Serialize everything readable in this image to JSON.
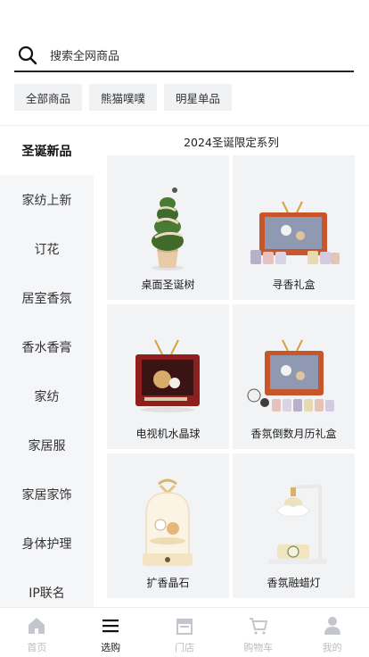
{
  "search": {
    "placeholder": "搜索全网商品",
    "icon": "search-icon"
  },
  "chips": [
    "全部商品",
    "熊猫噗噗",
    "明星单品"
  ],
  "sidebar": {
    "items": [
      "圣诞新品",
      "家纺上新",
      "订花",
      "居室香氛",
      "香水香膏",
      "家纺",
      "家居服",
      "家居家饰",
      "身体护理",
      "IP联名"
    ],
    "active_index": 0
  },
  "section": {
    "title": "2024圣诞限定系列"
  },
  "products": [
    {
      "name": "桌面圣诞树",
      "icon": "christmas-tree-image"
    },
    {
      "name": "寻香礼盒",
      "icon": "retro-tv-gift-box-image"
    },
    {
      "name": "电视机水晶球",
      "icon": "tv-crystal-ball-image"
    },
    {
      "name": "香氛倒数月历礼盒",
      "icon": "advent-calendar-gift-box-image"
    },
    {
      "name": "扩香晶石",
      "icon": "diffuser-crystal-dome-image"
    },
    {
      "name": "香氛融蜡灯",
      "icon": "wax-melt-lamp-image"
    }
  ],
  "tabbar": {
    "items": [
      {
        "label": "首页",
        "icon": "home-icon"
      },
      {
        "label": "选购",
        "icon": "menu-icon"
      },
      {
        "label": "门店",
        "icon": "store-icon"
      },
      {
        "label": "购物车",
        "icon": "cart-icon"
      },
      {
        "label": "我的",
        "icon": "profile-icon"
      }
    ],
    "active_index": 1
  },
  "colors": {
    "text": "#222222",
    "inactive": "#b9bcc2",
    "card_bg": "#f2f3f5",
    "sidebar_bg": "#f5f6f8"
  }
}
